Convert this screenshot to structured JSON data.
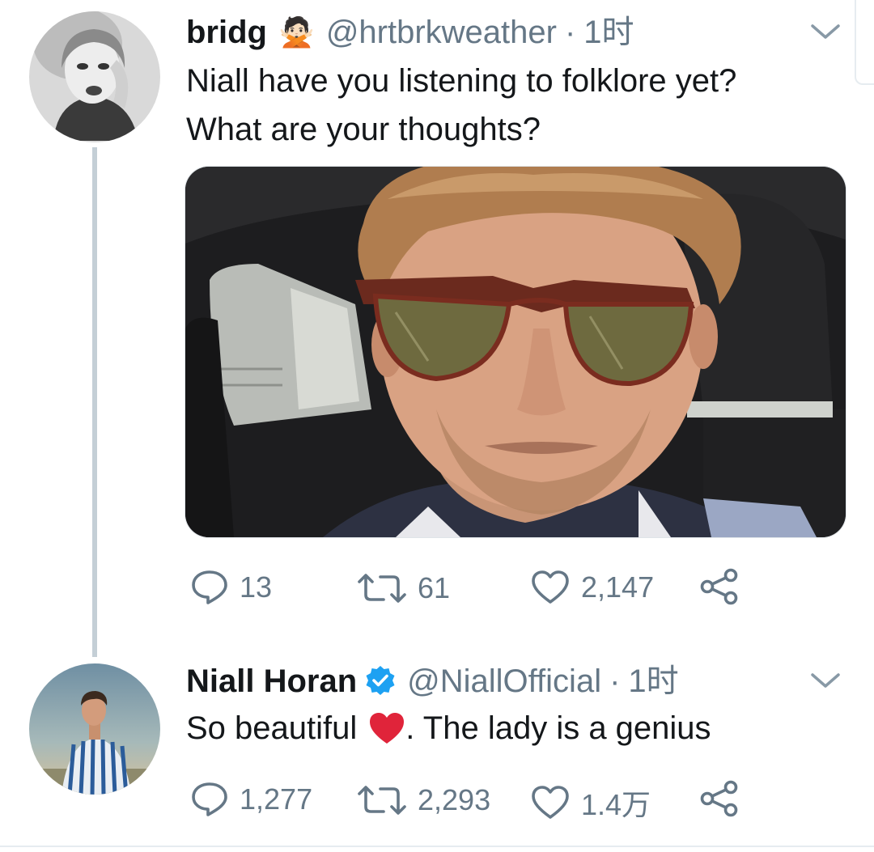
{
  "tweets": [
    {
      "display_name": "bridg",
      "emoji": "🙅🏻",
      "handle": "@hrtbrkweather",
      "separator": "·",
      "time": "1时",
      "text_line1": "Niall have you listening to folklore yet?",
      "text_line2": "What are your thoughts?",
      "replies": "13",
      "retweets": "61",
      "likes": "2,147"
    },
    {
      "display_name": "Niall Horan",
      "handle": "@NiallOfficial",
      "separator": "·",
      "time": "1时",
      "text_before": "So beautiful",
      "text_after": ". The lady is a genius",
      "replies": "1,277",
      "retweets": "2,293",
      "likes": "1.4万"
    }
  ],
  "colors": {
    "text": "#14171a",
    "secondary": "#657786",
    "verified": "#1da1f2",
    "heart": "#e0245e",
    "thread_line": "#c4cfd6"
  },
  "icons": [
    "chevron-down-icon",
    "reply-icon",
    "retweet-icon",
    "like-icon",
    "share-icon",
    "verified-badge-icon",
    "red-heart-icon"
  ]
}
